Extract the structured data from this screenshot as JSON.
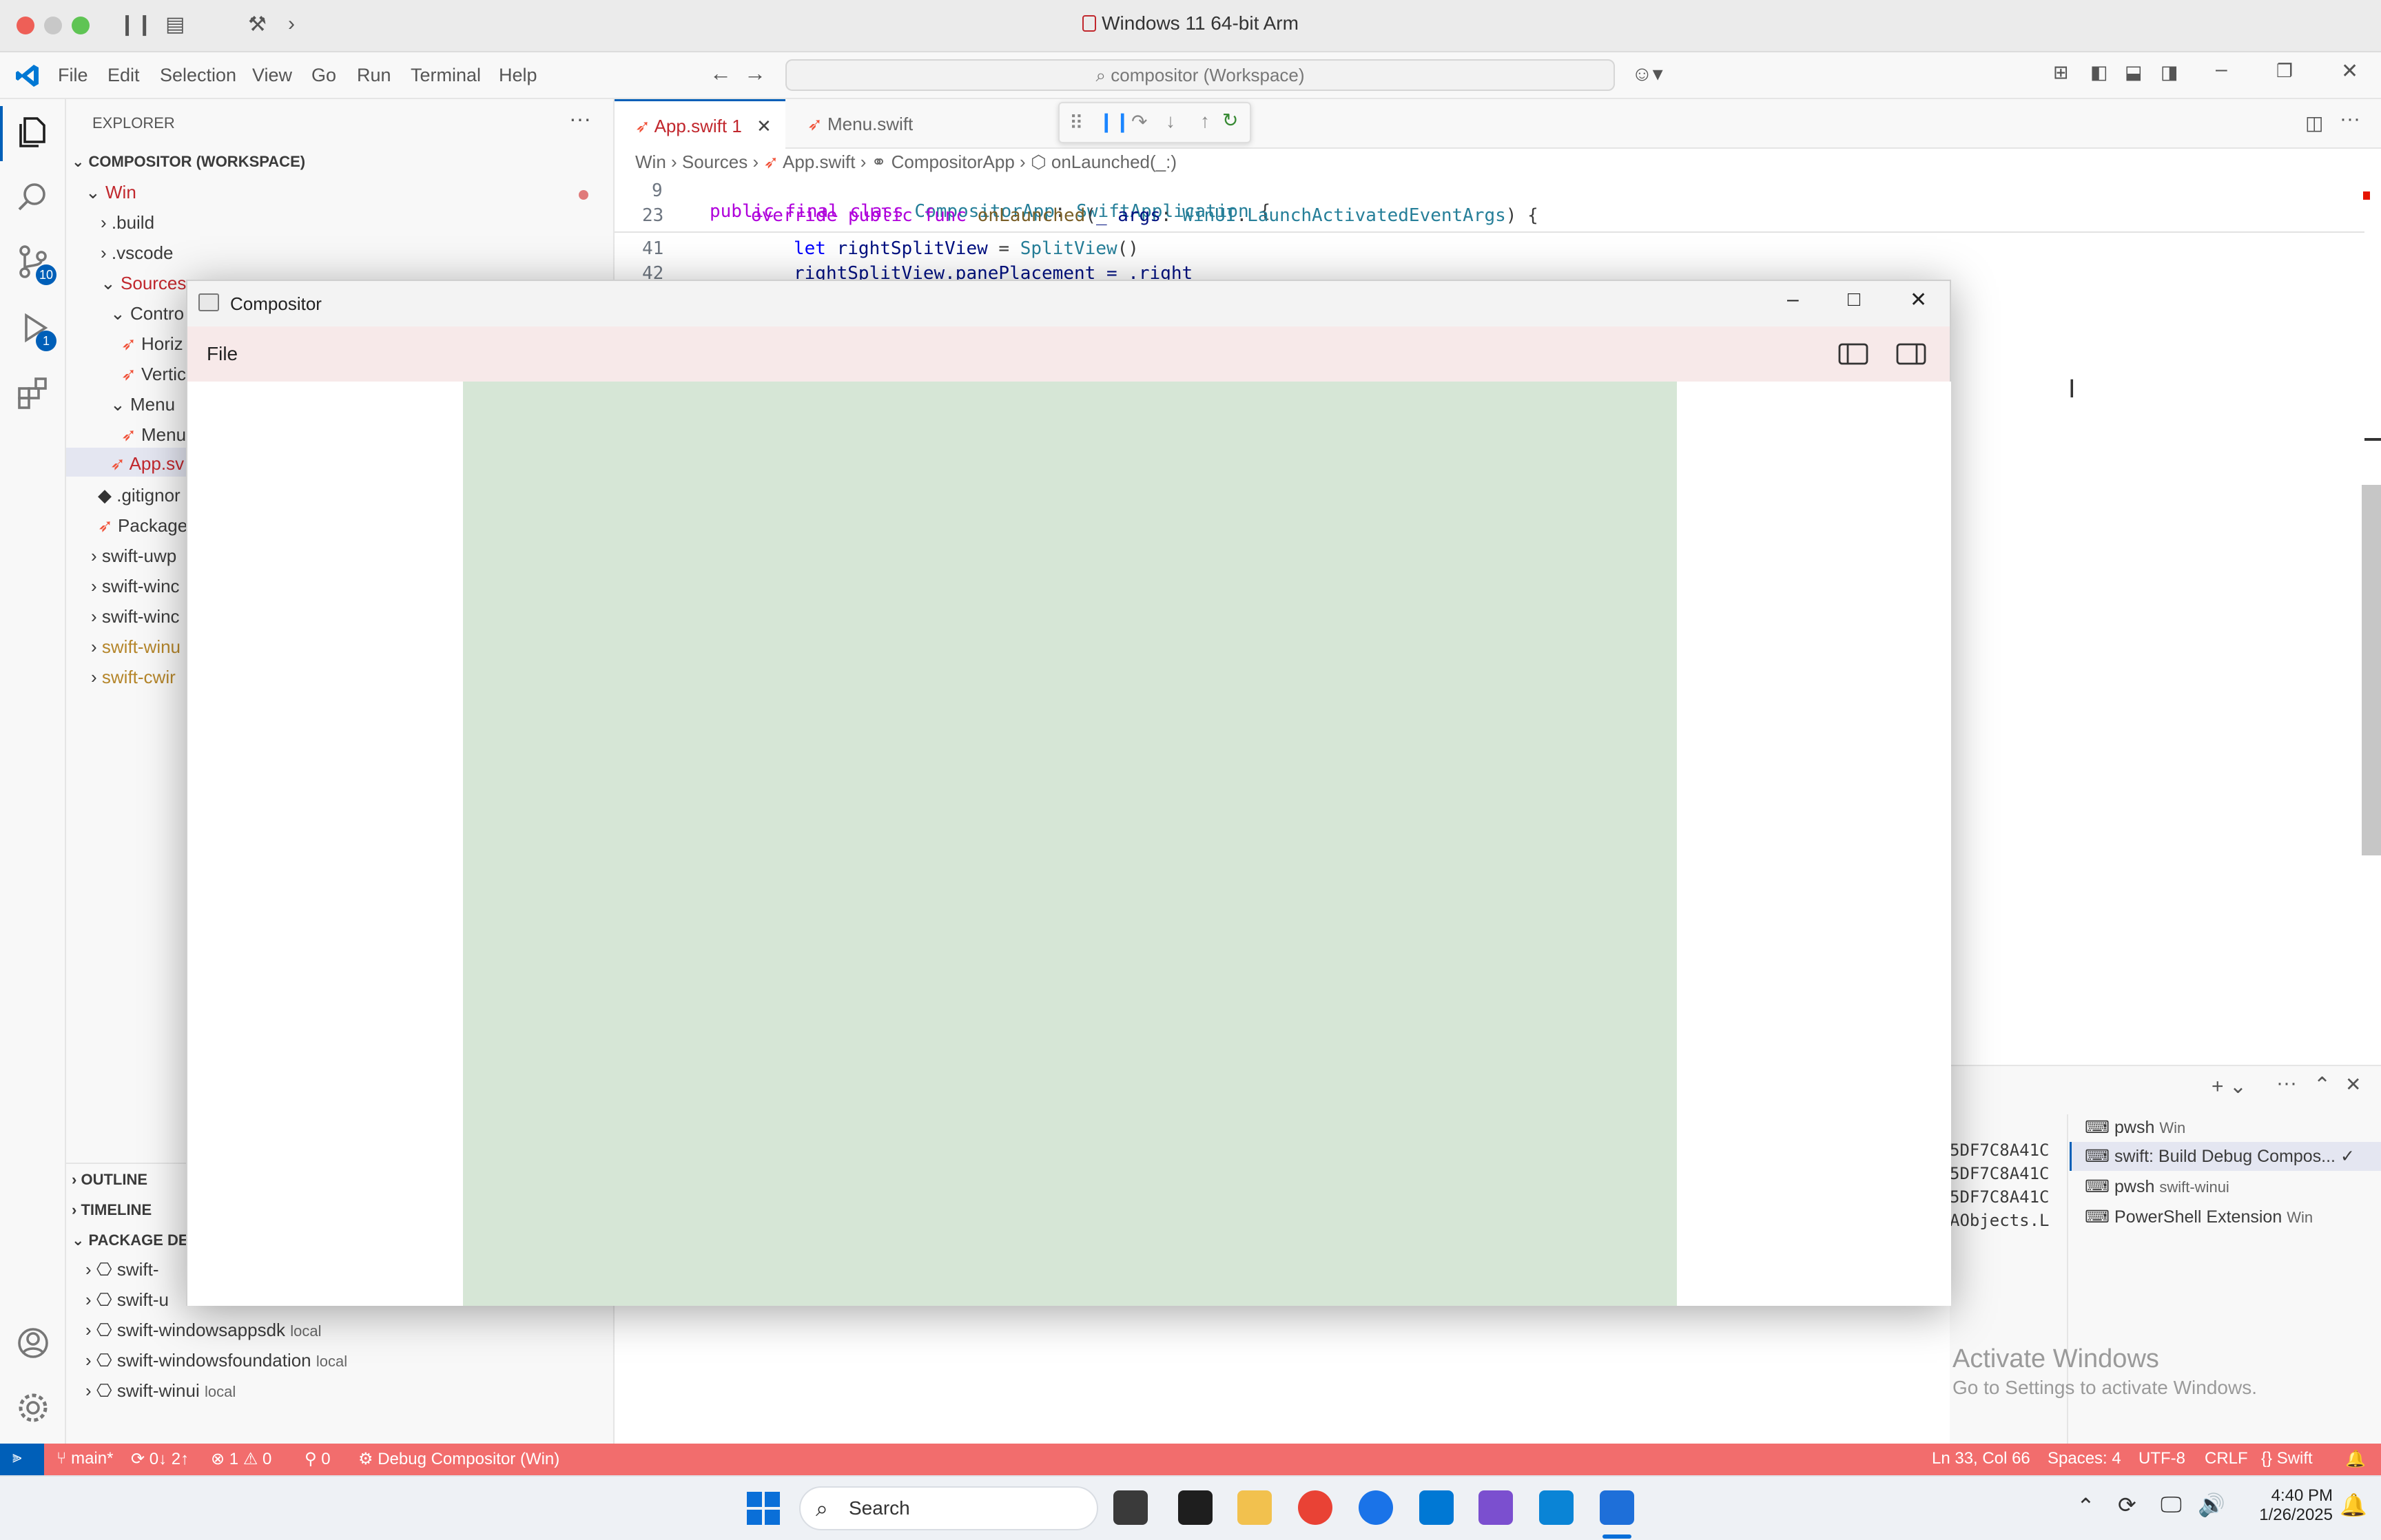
{
  "mac": {
    "title": "Windows 11 64-bit Arm"
  },
  "vscode": {
    "menus": [
      "File",
      "Edit",
      "Selection",
      "View",
      "Go",
      "Run",
      "Terminal",
      "Help"
    ],
    "command_center": "compositor (Workspace)",
    "explorer": {
      "header": "EXPLORER",
      "workspace": "COMPOSITOR (WORKSPACE)",
      "tree": [
        {
          "label": "Win",
          "depth": 0,
          "kind": "folder-open",
          "color": "#c1272d"
        },
        {
          "label": ".build",
          "depth": 1,
          "kind": "folder"
        },
        {
          "label": ".vscode",
          "depth": 1,
          "kind": "folder"
        },
        {
          "label": "Sources",
          "depth": 1,
          "kind": "folder-open",
          "color": "#c1272d"
        },
        {
          "label": "Contro",
          "depth": 2,
          "kind": "folder-open"
        },
        {
          "label": "Horiz",
          "depth": 3,
          "kind": "swift"
        },
        {
          "label": "Vertic",
          "depth": 3,
          "kind": "swift"
        },
        {
          "label": "Menu",
          "depth": 2,
          "kind": "folder-open"
        },
        {
          "label": "Menu",
          "depth": 3,
          "kind": "swift"
        },
        {
          "label": "App.sv",
          "depth": 2,
          "kind": "swift-selected",
          "color": "#c1272d"
        },
        {
          "label": ".gitignor",
          "depth": 1,
          "kind": "git"
        },
        {
          "label": "Package",
          "depth": 1,
          "kind": "swift"
        },
        {
          "label": "swift-uwp",
          "depth": 0,
          "kind": "folder"
        },
        {
          "label": "swift-winc",
          "depth": 0,
          "kind": "folder"
        },
        {
          "label": "swift-winc",
          "depth": 0,
          "kind": "folder"
        },
        {
          "label": "swift-winu",
          "depth": 0,
          "kind": "folder",
          "color": "#b5862b"
        },
        {
          "label": "swift-cwir",
          "depth": 0,
          "kind": "folder",
          "color": "#b5862b"
        }
      ],
      "sections": [
        "OUTLINE",
        "TIMELINE",
        "PACKAGE DEI"
      ],
      "packages": [
        {
          "name": "swift-",
          "tag": ""
        },
        {
          "name": "swift-u",
          "tag": ""
        },
        {
          "name": "swift-windowsappsdk",
          "tag": "local"
        },
        {
          "name": "swift-windowsfoundation",
          "tag": "local"
        },
        {
          "name": "swift-winui",
          "tag": "local"
        }
      ]
    },
    "tabs": [
      {
        "label": "App.swift",
        "badge": "1",
        "active": true
      },
      {
        "label": "Menu.swift",
        "badge": "",
        "active": false
      }
    ],
    "breadcrumb": [
      "Win",
      "Sources",
      "App.swift",
      "CompositorApp",
      "onLaunched(_:)"
    ],
    "code": {
      "line9_no": "9",
      "line9": "public final class CompositorApp: SwiftApplication {",
      "line23_no": "23",
      "line23": "override public func onLaunched(_ args: WinUI.LaunchActivatedEventArgs) {",
      "line41_no": "41",
      "line41": "let rightSplitView = SplitView()",
      "line42_no": "42",
      "line42": "rightSplitView.panePlacement = .right"
    },
    "terminal": {
      "output": [
        "5DF7C8A41C",
        "5DF7C8A41C",
        "5DF7C8A41C",
        "AObjects.L"
      ],
      "list": [
        {
          "name": "pwsh",
          "ctx": "Win",
          "selected": false
        },
        {
          "name": "swift: Build Debug Compos...",
          "ctx": "",
          "selected": true
        },
        {
          "name": "pwsh",
          "ctx": "swift-winui",
          "selected": false
        },
        {
          "name": "PowerShell Extension",
          "ctx": "Win",
          "selected": false
        }
      ]
    },
    "activate": {
      "title": "Activate Windows",
      "subtitle": "Go to Settings to activate Windows."
    },
    "badges": {
      "scm": "10",
      "debug": "1"
    },
    "status": {
      "branch": "main*",
      "sync": "0↓ 2↑",
      "errors": "1",
      "warnings": "0",
      "ports": "0",
      "debug": "Debug Compositor (Win)",
      "position": "Ln 33, Col 66",
      "spaces": "Spaces: 4",
      "encoding": "UTF-8",
      "eol": "CRLF",
      "language": "Swift"
    }
  },
  "compositor": {
    "title": "Compositor",
    "menu": "File",
    "colors": {
      "menubar": "#f7e9e9",
      "pane": "#d6e6d6"
    }
  },
  "taskbar": {
    "search": "Search",
    "time": "4:40 PM",
    "date": "1/26/2025"
  }
}
